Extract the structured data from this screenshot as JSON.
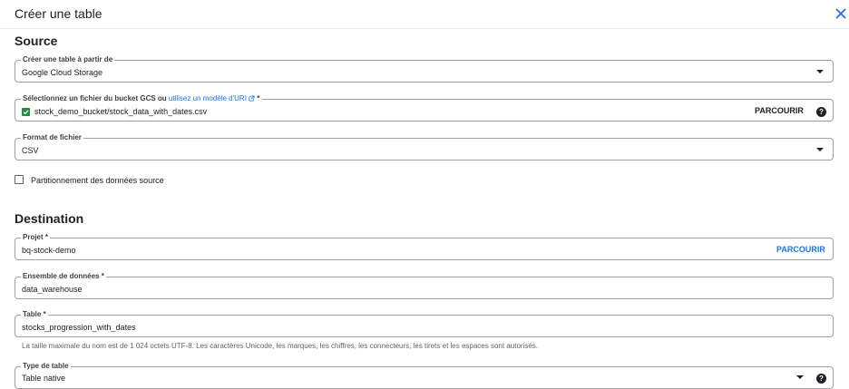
{
  "header": {
    "title": "Créer une table"
  },
  "source": {
    "title": "Source",
    "create_from": {
      "label": "Créer une table à partir de",
      "value": "Google Cloud Storage"
    },
    "gcs_file": {
      "label": "Sélectionnez un fichier du bucket GCS ou",
      "link": "utilisez un modèle d'URI",
      "required": "*",
      "value": "stock_demo_bucket/stock_data_with_dates.csv",
      "browse": "PARCOURIR"
    },
    "file_format": {
      "label": "Format de fichier",
      "value": "CSV"
    },
    "partitioning": {
      "label": "Partitionnement des données source",
      "checked": false
    }
  },
  "destination": {
    "title": "Destination",
    "project": {
      "label": "Projet *",
      "value": "bq-stock-demo",
      "browse": "PARCOURIR"
    },
    "dataset": {
      "label": "Ensemble de données *",
      "value": "data_warehouse"
    },
    "table": {
      "label": "Table *",
      "value": "stocks_progression_with_dates",
      "hint": "La taille maximale du nom est de 1 024 octets UTF-8. Les caractères Unicode, les marques, les chiffres, les connecteurs, les tirets et les espaces sont autorisés."
    },
    "table_type": {
      "label": "Type de table",
      "value": "Table native"
    }
  },
  "colors": {
    "accent": "#1a73e8",
    "check": "#1e8e3e",
    "border": "#9aa0a6"
  }
}
